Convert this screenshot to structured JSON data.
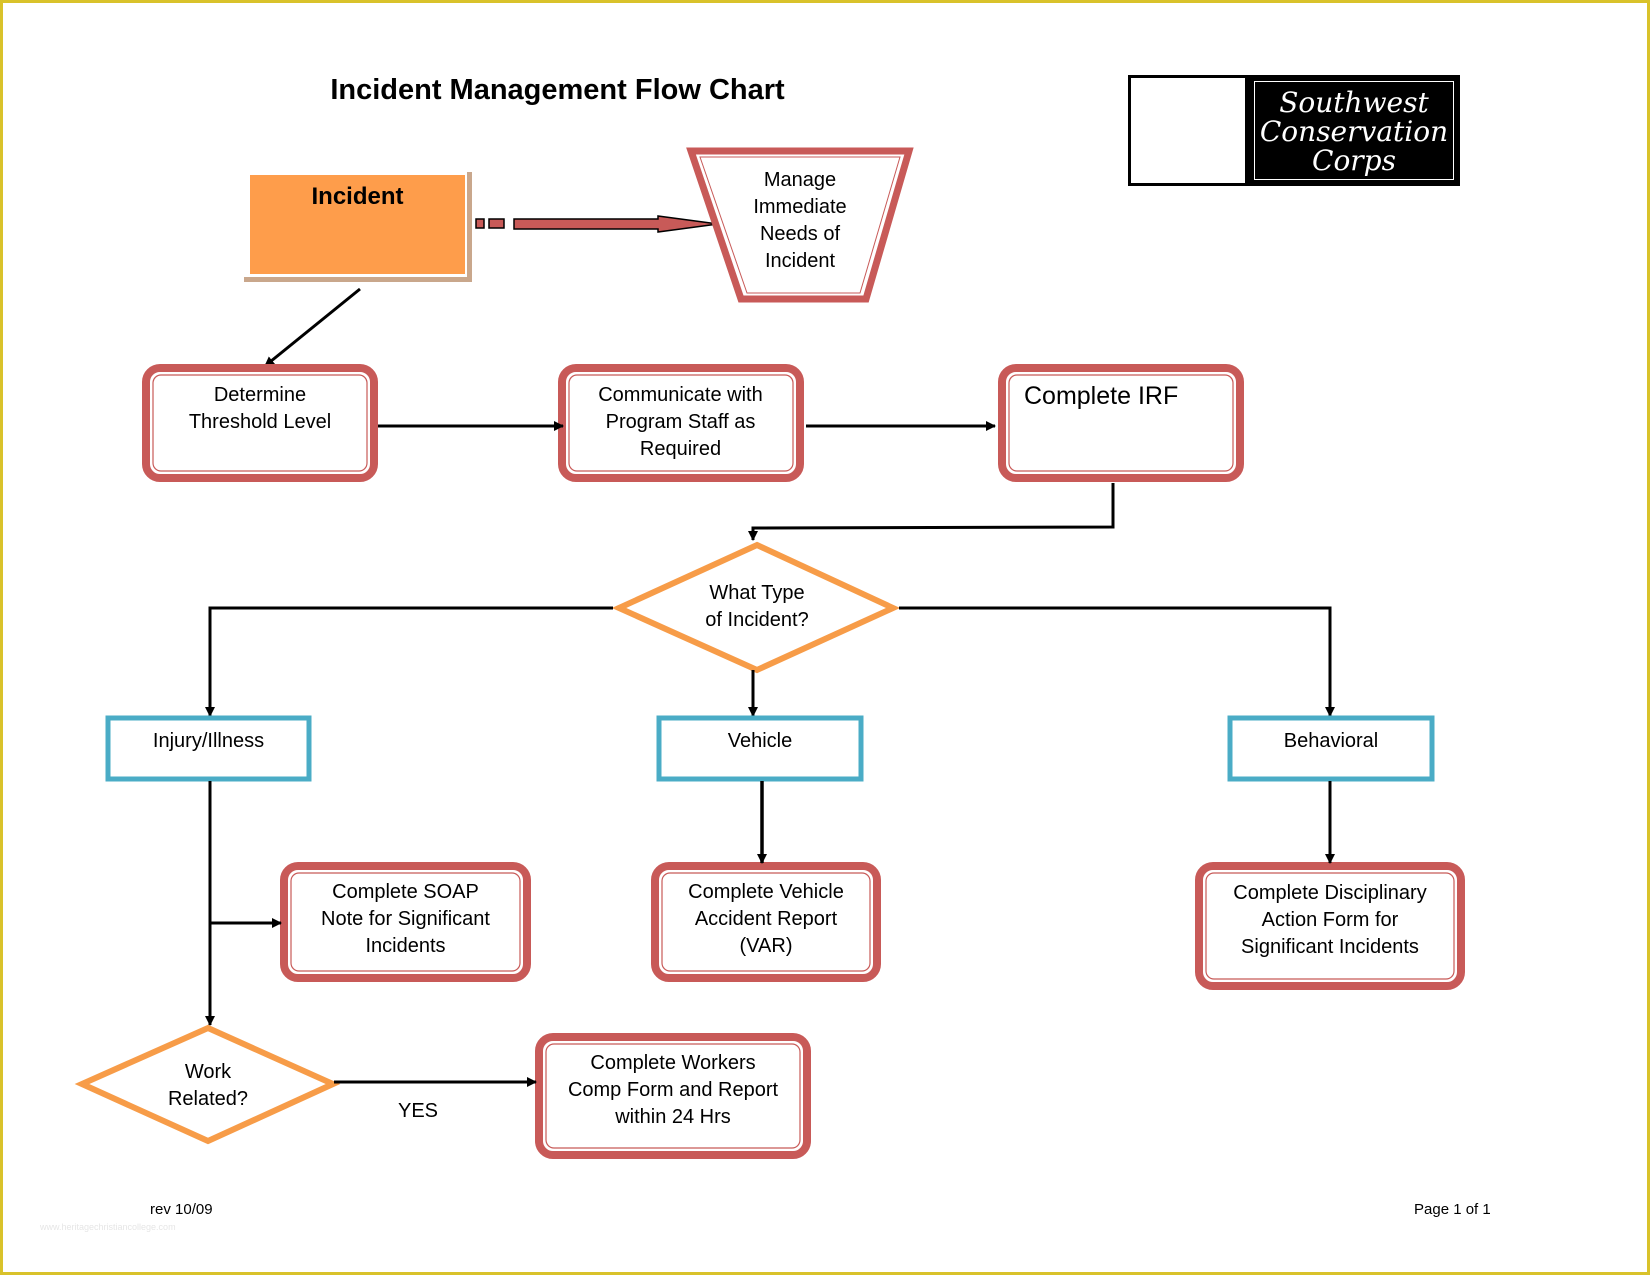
{
  "title": "Incident Management Flow Chart",
  "logo": {
    "icon": "celtic-shield-icon",
    "lines": [
      "Southwest",
      "Conservation",
      "Corps"
    ]
  },
  "colors": {
    "process_border": "#c85a58",
    "start_fill": "#fe9d4b",
    "decision_border": "#f79c48",
    "category_border": "#4aacc6",
    "connector": "#000000",
    "page_border": "#d9c22a"
  },
  "nodes": {
    "incident": {
      "label": "Incident",
      "shape": "rectangle"
    },
    "manage": {
      "lines": [
        "Manage",
        "Immediate",
        "Needs of",
        "Incident"
      ],
      "shape": "trapezoid"
    },
    "determine": {
      "lines": [
        "Determine",
        "Threshold Level"
      ],
      "shape": "rounded-rectangle"
    },
    "communicate": {
      "lines": [
        "Communicate with",
        "Program Staff as",
        "Required"
      ],
      "shape": "rounded-rectangle"
    },
    "irf": {
      "label": "Complete IRF",
      "shape": "rounded-rectangle"
    },
    "type_decision": {
      "lines": [
        "What Type",
        "of Incident?"
      ],
      "shape": "diamond"
    },
    "injury": {
      "label": "Injury/Illness",
      "shape": "rectangle"
    },
    "vehicle": {
      "label": "Vehicle",
      "shape": "rectangle"
    },
    "behavioral": {
      "label": "Behavioral",
      "shape": "rectangle"
    },
    "soap": {
      "lines": [
        "Complete SOAP",
        "Note for Significant",
        "Incidents"
      ],
      "shape": "rounded-rectangle"
    },
    "var": {
      "lines": [
        "Complete Vehicle",
        "Accident Report",
        "(VAR)"
      ],
      "shape": "rounded-rectangle"
    },
    "disciplinary": {
      "lines": [
        "Complete Disciplinary",
        "Action Form for",
        "Significant Incidents"
      ],
      "shape": "rounded-rectangle"
    },
    "work_decision": {
      "lines": [
        "Work",
        "Related?"
      ],
      "shape": "diamond"
    },
    "workers_comp": {
      "lines": [
        "Complete Workers",
        "Comp Form and Report",
        "within 24 Hrs"
      ],
      "shape": "rounded-rectangle"
    }
  },
  "edges": [
    {
      "from": "incident",
      "to": "manage",
      "style": "dashed-block-arrow"
    },
    {
      "from": "incident",
      "to": "determine"
    },
    {
      "from": "determine",
      "to": "communicate"
    },
    {
      "from": "communicate",
      "to": "irf"
    },
    {
      "from": "irf",
      "to": "type_decision"
    },
    {
      "from": "type_decision",
      "to": "injury"
    },
    {
      "from": "type_decision",
      "to": "vehicle"
    },
    {
      "from": "type_decision",
      "to": "behavioral"
    },
    {
      "from": "injury",
      "to": "soap"
    },
    {
      "from": "injury",
      "to": "work_decision"
    },
    {
      "from": "vehicle",
      "to": "var"
    },
    {
      "from": "behavioral",
      "to": "disciplinary"
    },
    {
      "from": "work_decision",
      "to": "workers_comp",
      "label": "YES"
    }
  ],
  "edge_labels": {
    "yes": "YES"
  },
  "footer": {
    "revision": "rev 10/09",
    "page": "Page 1 of 1",
    "watermark": "www.heritagechristiancollege.com"
  }
}
